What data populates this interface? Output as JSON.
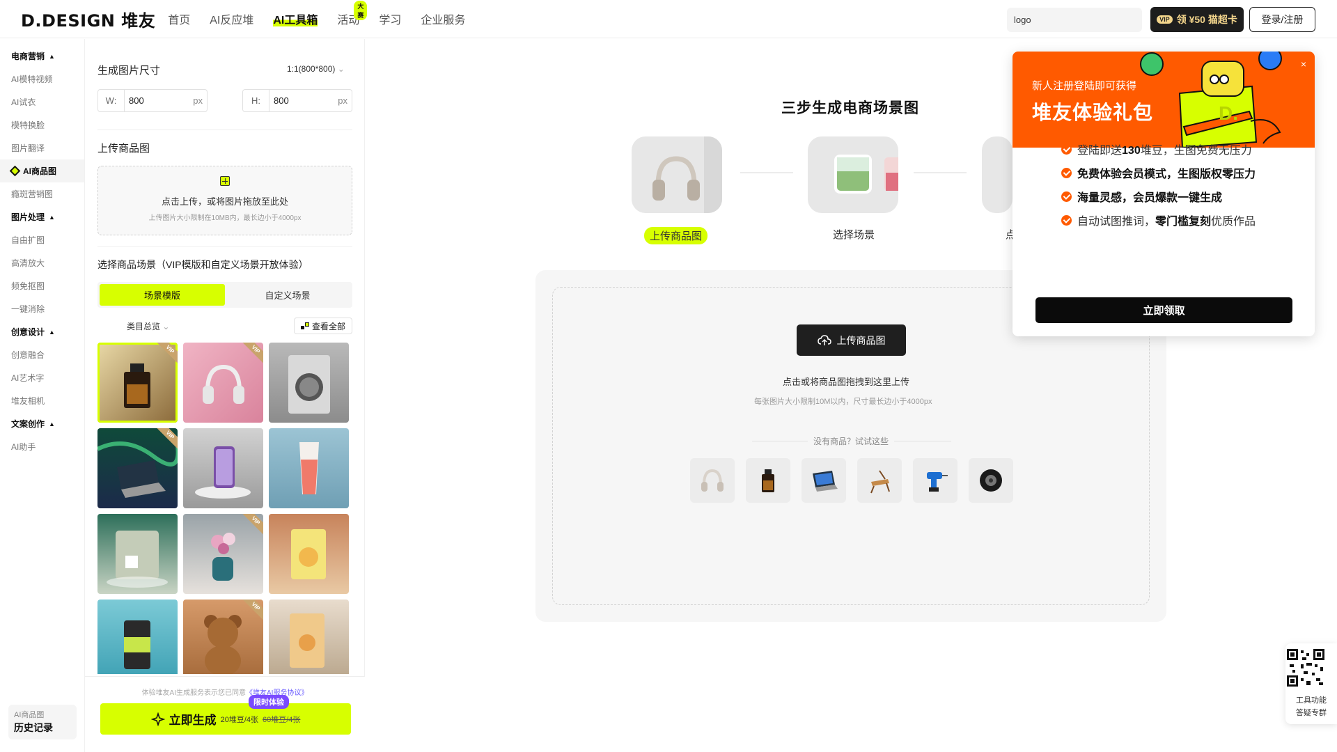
{
  "header": {
    "logo": "D.DESIGN 堆友",
    "nav": [
      {
        "label": "首页"
      },
      {
        "label": "AI反应堆"
      },
      {
        "label": "AI工具箱"
      },
      {
        "label": "活动",
        "badge": "大赛"
      },
      {
        "label": "学习"
      },
      {
        "label": "企业服务"
      }
    ],
    "search_value": "logo",
    "vip_tag": "VIP",
    "vip_label": "领 ¥50 猫超卡",
    "login_label": "登录/注册"
  },
  "sidebar": {
    "groups": [
      {
        "title": "电商营销",
        "items": [
          "AI模特视频",
          "AI试衣",
          "模特换脸",
          "图片翻译",
          "AI商品图",
          "瘾斑营销图"
        ]
      },
      {
        "title": "图片处理",
        "items": [
          "自由扩图",
          "高清放大",
          "频免抠图",
          "一键消除"
        ]
      },
      {
        "title": "创意设计",
        "items": [
          "创意融合",
          "AI艺术字",
          "堆友相机"
        ]
      },
      {
        "title": "文案创作",
        "items": [
          "AI助手"
        ]
      }
    ],
    "active_item": "AI商品图",
    "history_small": "AI商品图",
    "history_label": "历史记录"
  },
  "panel": {
    "size_title": "生成图片尺寸",
    "ratio": "1:1(800*800)",
    "width_label": "W:",
    "width_value": "800",
    "height_label": "H:",
    "height_value": "800",
    "unit": "px",
    "upload_title": "上传商品图",
    "upload_text": "点击上传，或将图片拖放至此处",
    "upload_hint": "上传图片大小限制在10MB内，最长边小于4000px",
    "scene_title": "选择商品场景（VIP模版和自定义场景开放体验）",
    "tabs": [
      "场景模版",
      "自定义场景"
    ],
    "category": "类目总览",
    "view_all": "查看全部",
    "tiles": [
      {
        "name": "perfume",
        "vip": true
      },
      {
        "name": "headphones-pink",
        "vip": true
      },
      {
        "name": "washing-machine",
        "vip": false
      },
      {
        "name": "laptop-aurora",
        "vip": true
      },
      {
        "name": "phone-stand",
        "vip": false
      },
      {
        "name": "tube-product",
        "vip": false
      },
      {
        "name": "coffee-machine",
        "vip": false
      },
      {
        "name": "flower-vase",
        "vip": true
      },
      {
        "name": "snack-bag",
        "vip": false
      },
      {
        "name": "drink-can",
        "vip": false
      },
      {
        "name": "teddy-bear",
        "vip": true
      },
      {
        "name": "cat-food-bag",
        "vip": false
      }
    ],
    "vip_badge": "VIP",
    "agree_prefix": "体验堆友AI生成服务表示您已同意",
    "agree_link": "《堆友AI服务协议》",
    "generate_label": "立即生成",
    "generate_price": "20堆豆/4张",
    "generate_old_price": "60堆豆/4张",
    "limited_tag": "限时体验"
  },
  "main": {
    "title": "三步生成电商场景图",
    "steps": [
      "上传商品图",
      "选择场景",
      "点"
    ],
    "upload_button": "上传商品图",
    "drop_text": "点击或将商品图拖拽到这里上传",
    "drop_hint": "每张图片大小限制10M以内，尺寸最长边小于4000px",
    "try_label": "没有商品？试试这些",
    "samples": [
      "headphones",
      "perfume",
      "laptop",
      "chair",
      "drill",
      "tire"
    ]
  },
  "popup": {
    "sub": "新人注册登陆即可获得",
    "title": "堆友体验礼包",
    "perks": [
      {
        "pre": "登陆即送",
        "bold": "130",
        "post": "堆豆，生图免费无压力"
      },
      {
        "pre": "",
        "bold": "免费体验会员模式，生图版权零压力",
        "post": ""
      },
      {
        "pre": "",
        "bold": "海量灵感，会员爆款一键生成",
        "post": ""
      },
      {
        "pre": "自动试图推词，",
        "bold": "零门槛复刻",
        "post": "优质作品"
      }
    ],
    "claim_label": "立即领取",
    "close": "×"
  },
  "qr_float": {
    "line1": "工具功能",
    "line2": "答疑专群"
  },
  "colors": {
    "accent": "#d7ff00",
    "orange": "#ff5a00",
    "dark": "#1f1f1f"
  }
}
